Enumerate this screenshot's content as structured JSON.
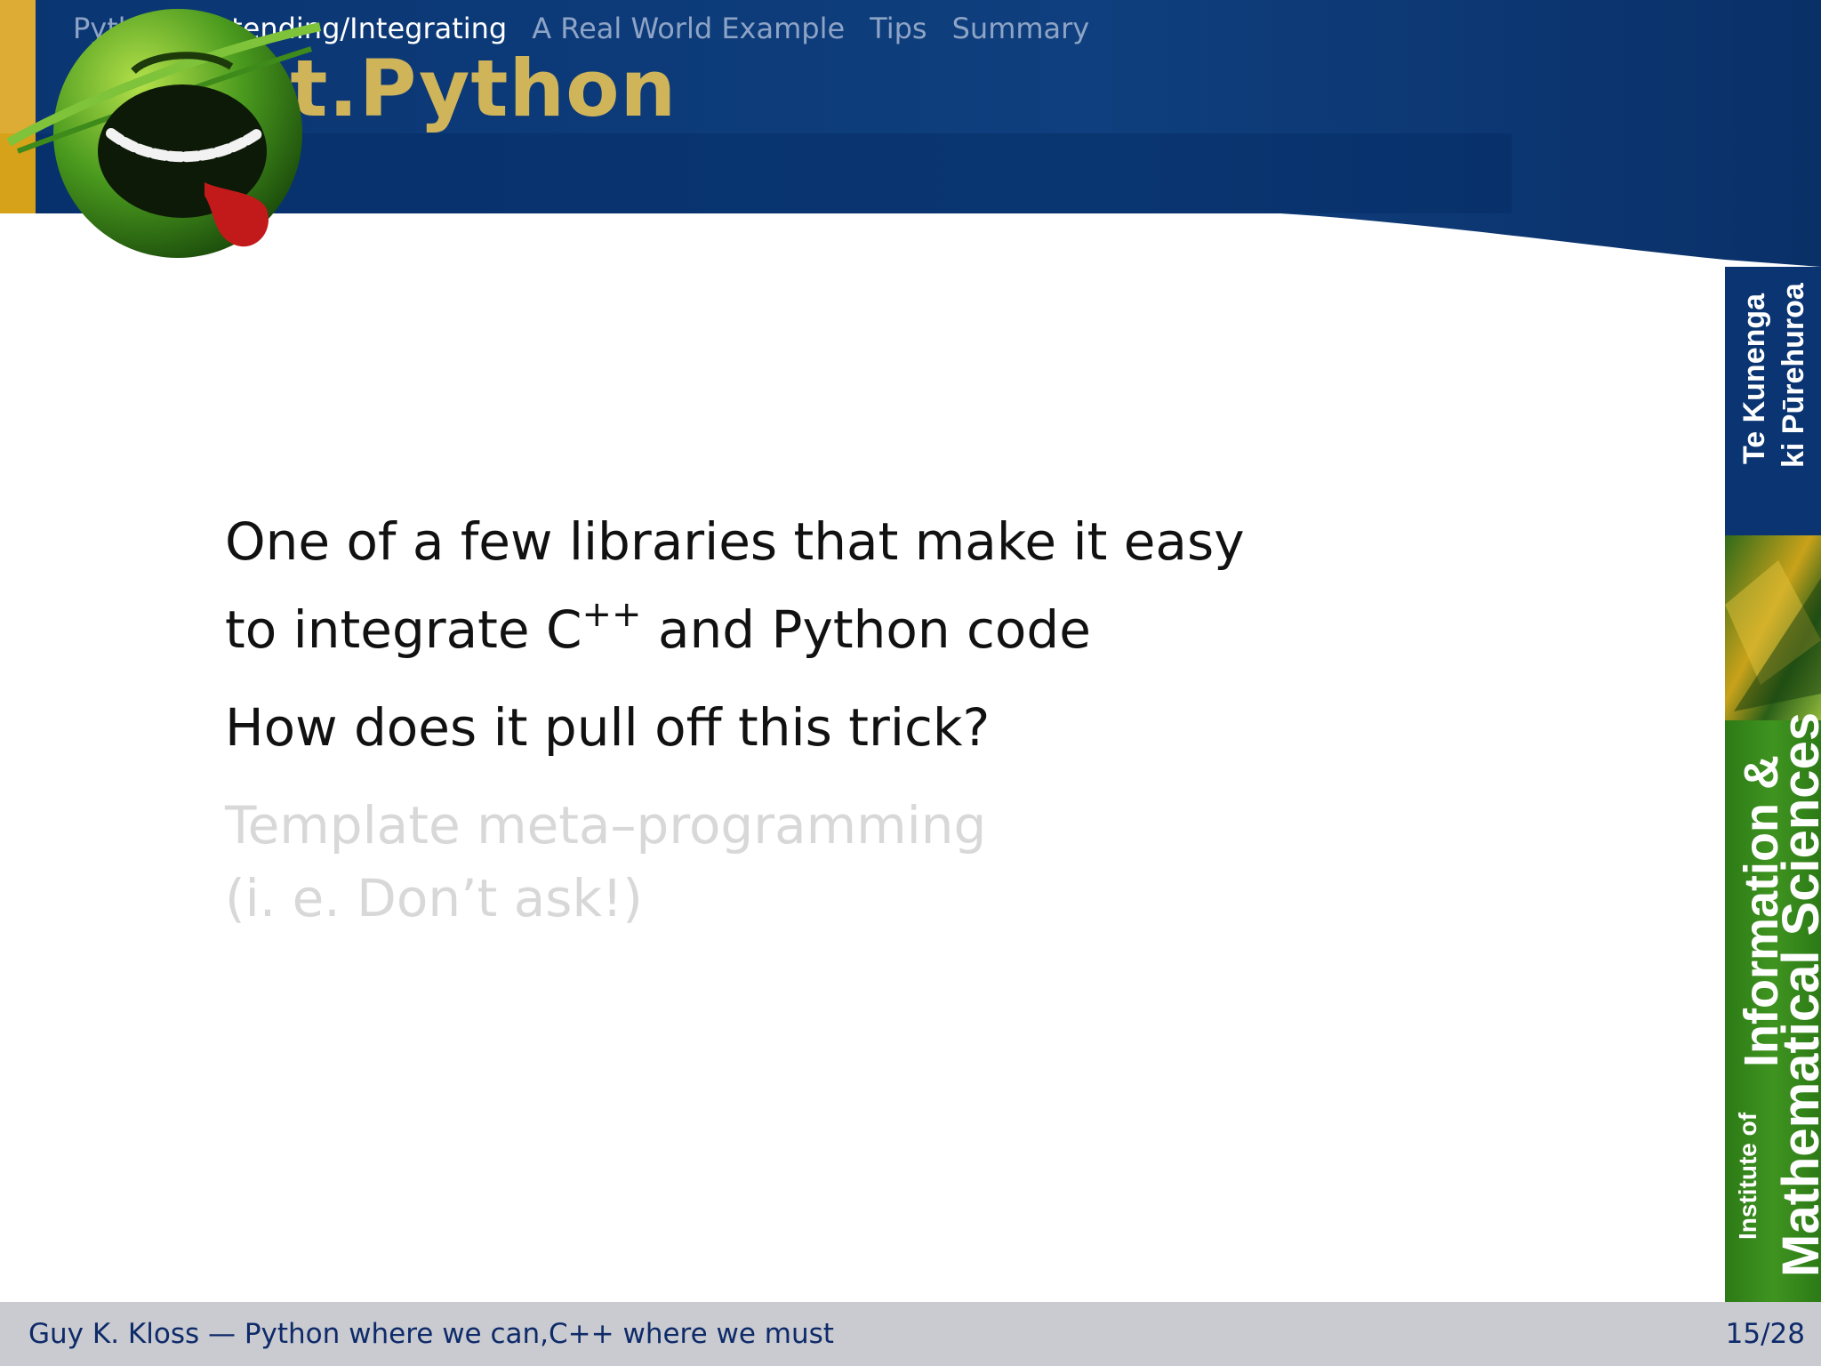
{
  "nav": {
    "sections": [
      "Python",
      "Extending/Integrating",
      "A Real World Example",
      "Tips",
      "Summary"
    ],
    "active_index": 1
  },
  "frame": {
    "title": "Boost.Python"
  },
  "body": {
    "item1_line1": "One of a few libraries that make it easy",
    "item1_line2_pre": "to integrate C",
    "item1_line2_sup": "++",
    "item1_line2_post": " and Python code",
    "item2": "How does it pull off this trick?",
    "item3_line1": "Template meta–programming",
    "item3_line2": "(i. e. Don’t ask!)"
  },
  "sidebar": {
    "maori_line1": "Te Kunenga",
    "maori_line2": "ki Pūrehuroa",
    "institute_line1": "Institute of",
    "institute_line2": "Information &",
    "institute_line3": "Mathematical Sciences"
  },
  "footer": {
    "author_title": "Guy K. Kloss — Python where we can,C++ where we must",
    "page": "15/28"
  },
  "colors": {
    "header_blue": "#0b3a78",
    "title_gold": "#cfb45a",
    "accent_bar": "#d6a21a",
    "footer_bg": "#c9cbd0",
    "footer_text": "#0e2a69",
    "faded_text": "#d8d8d8"
  }
}
